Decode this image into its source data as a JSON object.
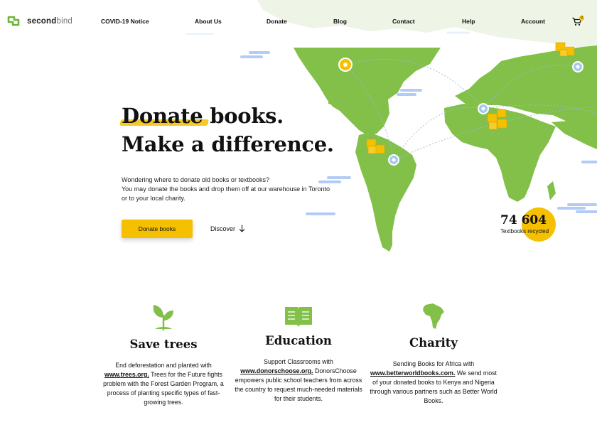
{
  "brand": {
    "name_bold": "second",
    "name_light": "bind"
  },
  "nav": {
    "items": [
      "COVID-19 Notice",
      "About Us",
      "Donate",
      "Blog",
      "Contact",
      "Help",
      "Account"
    ],
    "cart_count": "0"
  },
  "hero": {
    "title_highlight": "Donate",
    "title_rest": " books.",
    "title_line2": "Make a difference.",
    "subtitle_line1": "Wondering where to donate old books or textbooks?",
    "subtitle_line2": "You may donate the books and drop them off at our warehouse in Toronto or to your local charity.",
    "primary_button": "Donate books",
    "secondary_link": "Discover"
  },
  "stat": {
    "value": "74 604",
    "label": "Textbooks recycled"
  },
  "features": [
    {
      "title": "Save trees",
      "icon": "sprout-icon",
      "desc_before": "End deforestation and planted with ",
      "link": "www.trees.org.",
      "desc_after": " Trees for the Future fights problem with the Forest Garden Program, a process of planting specific types of fast-growing trees."
    },
    {
      "title": "Education",
      "icon": "open-book-icon",
      "desc_before": "Support Classrooms with ",
      "link": "www.donorschoose.org.",
      "desc_after": " DonorsChoose empowers public school teachers from across the country to request much-needed materials for their students."
    },
    {
      "title": "Charity",
      "icon": "africa-icon",
      "desc_before": "Sending Books for Africa with ",
      "link": "www.betterworldbooks.com.",
      "desc_after": " We send most of your donated books to Kenya and Nigeria through various partners such as Better World Books."
    }
  ],
  "colors": {
    "accent": "#f5c000",
    "map_green": "#82c04a",
    "cloud_blue": "#b3ccf5",
    "route_blue": "#9ab9d8"
  }
}
